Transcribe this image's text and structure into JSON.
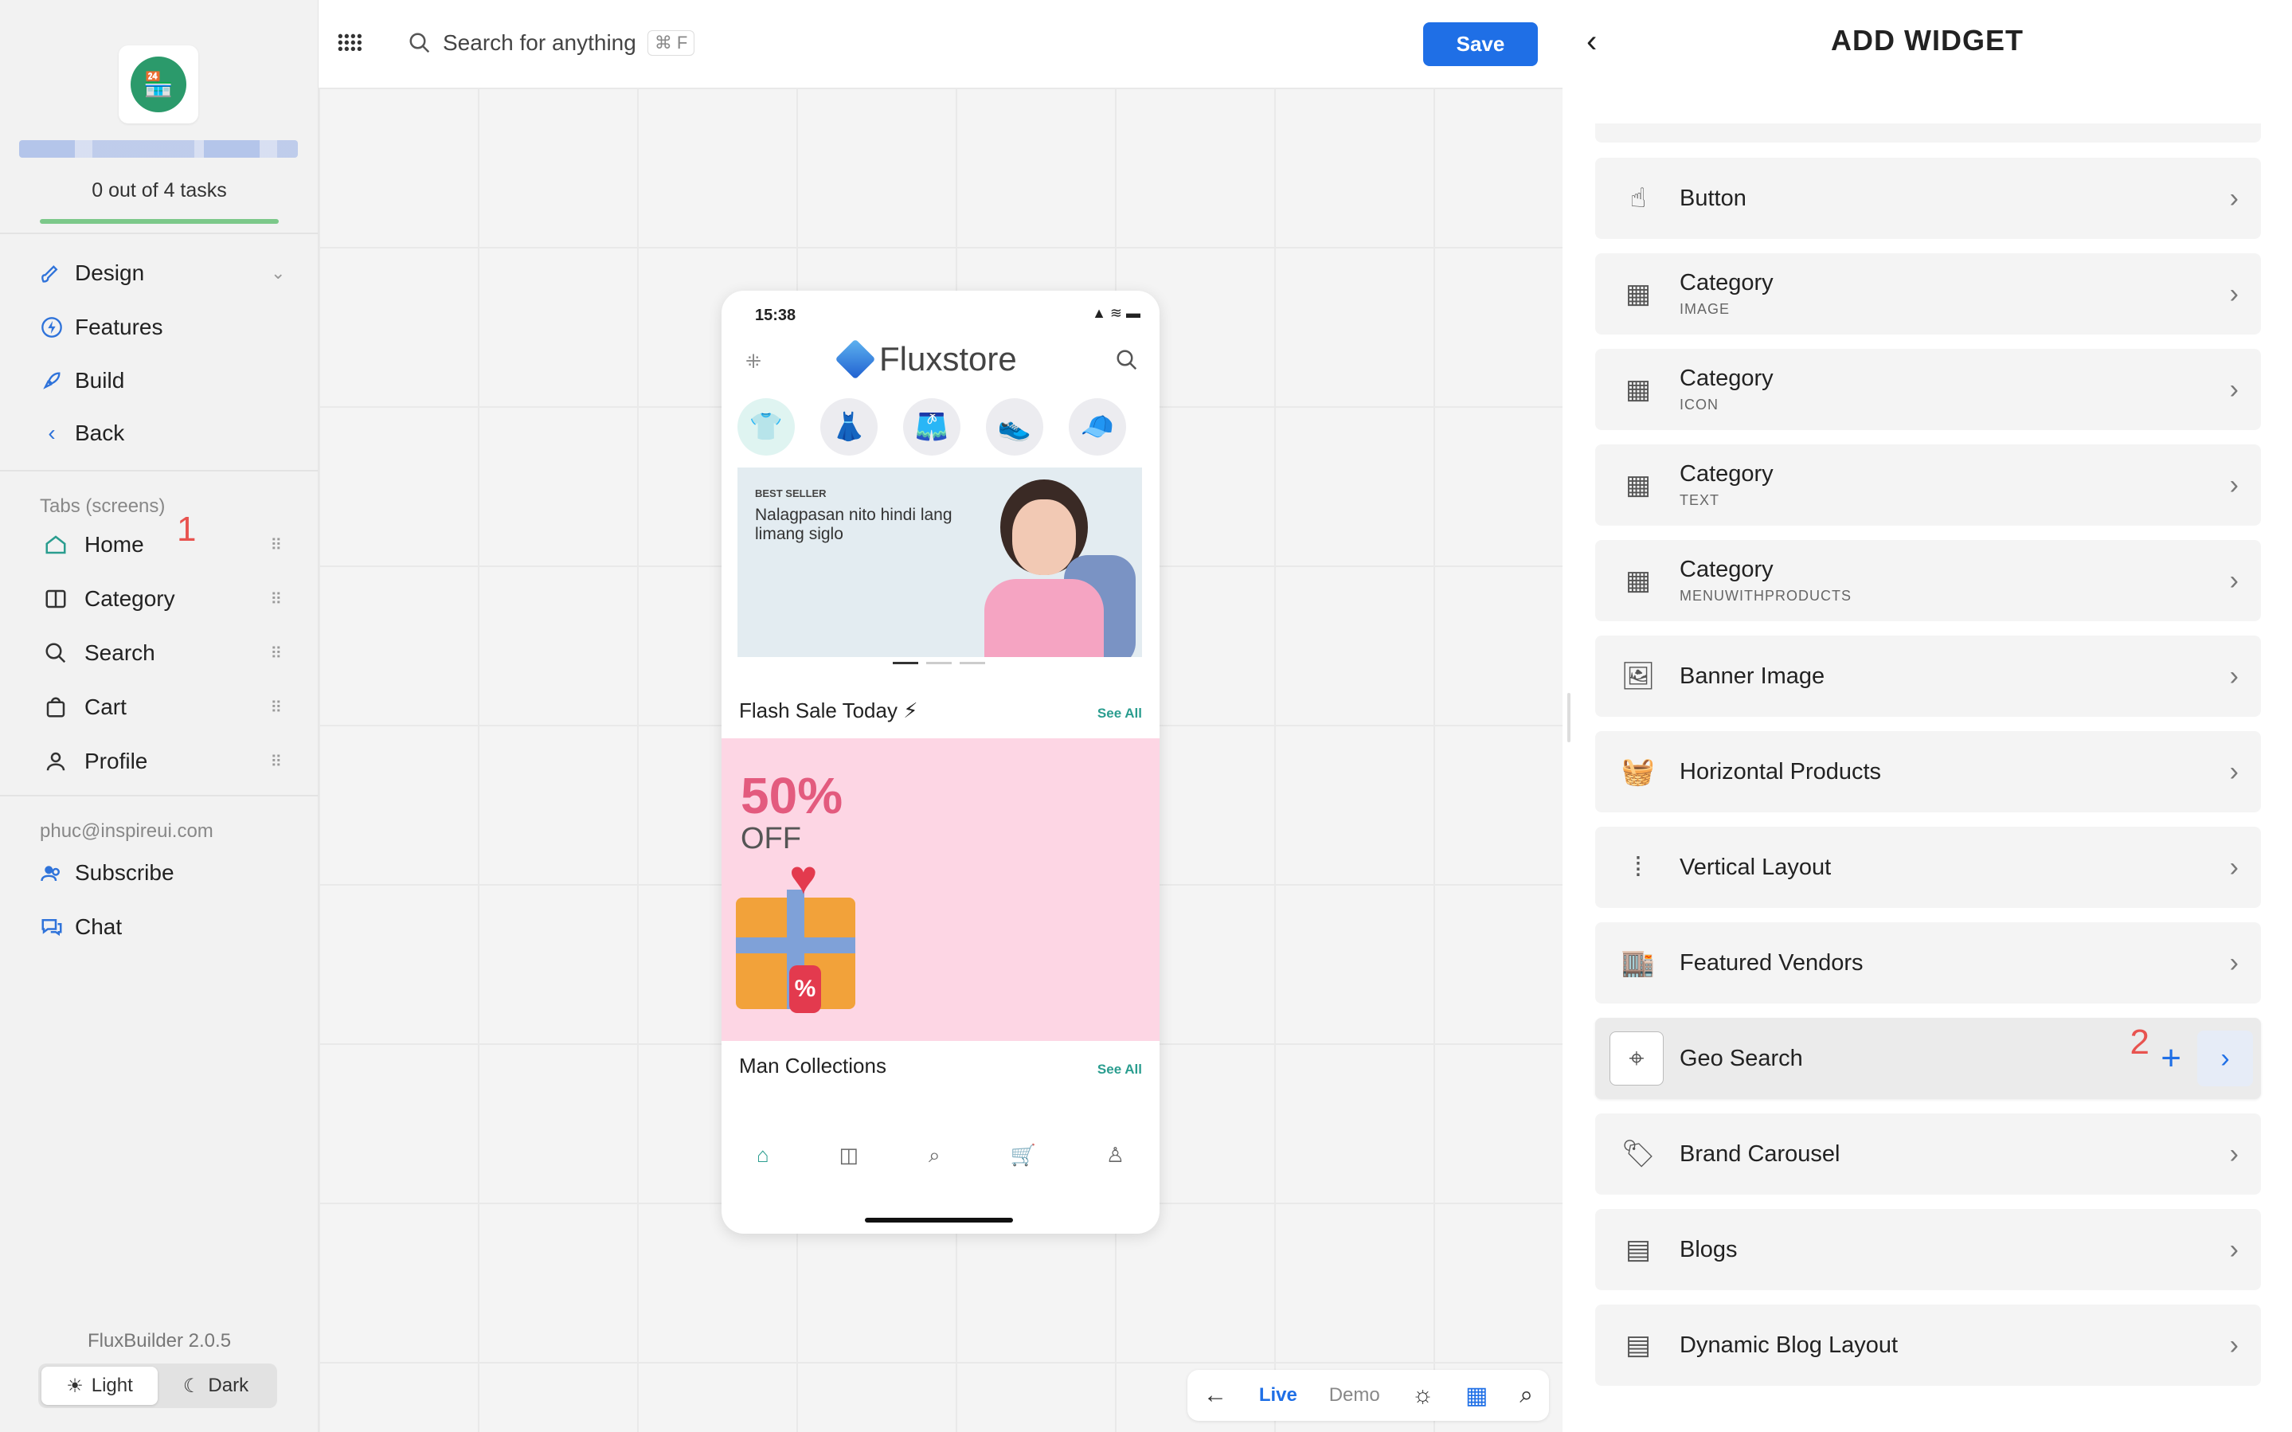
{
  "sidebar": {
    "tasks_label": "0 out of 4 tasks",
    "nav": [
      {
        "label": "Design",
        "icon": "brush-icon"
      },
      {
        "label": "Features",
        "icon": "bolt-icon"
      },
      {
        "label": "Build",
        "icon": "rocket-icon"
      },
      {
        "label": "Back",
        "icon": "chevron-left-icon"
      }
    ],
    "tabs_label": "Tabs (screens)",
    "tabs": [
      {
        "label": "Home",
        "icon": "home-icon"
      },
      {
        "label": "Category",
        "icon": "columns-icon"
      },
      {
        "label": "Search",
        "icon": "search-icon"
      },
      {
        "label": "Cart",
        "icon": "cart-icon"
      },
      {
        "label": "Profile",
        "icon": "user-icon"
      }
    ],
    "step_marker_1": "1",
    "email": "phuc@inspireui.com",
    "account_items": [
      {
        "label": "Subscribe",
        "icon": "users-icon"
      },
      {
        "label": "Chat",
        "icon": "chat-icon"
      }
    ],
    "version": "FluxBuilder 2.0.5",
    "theme": {
      "light": "Light",
      "dark": "Dark"
    }
  },
  "topbar": {
    "search_placeholder": "Search for anything",
    "shortcut": "⌘ F",
    "save_label": "Save"
  },
  "phone": {
    "time": "15:38",
    "brand": "Fluxstore",
    "banner_tag": "BEST SELLER",
    "banner_text": "Nalagpasan nito hindi lang limang siglo",
    "flash_title": "Flash Sale Today ⚡",
    "see_all": "See All",
    "sale_percent": "50%",
    "sale_off": "OFF",
    "sale_tag": "%",
    "collections_title": "Man Collections"
  },
  "preview_bar": {
    "live": "Live",
    "demo": "Demo"
  },
  "panel": {
    "title": "ADD WIDGET",
    "step_marker_2": "2",
    "widgets": [
      {
        "name": "Button",
        "sub": "",
        "icon": "hand-pointer-icon"
      },
      {
        "name": "Category",
        "sub": "IMAGE",
        "icon": "grid-icon"
      },
      {
        "name": "Category",
        "sub": "ICON",
        "icon": "grid-icon"
      },
      {
        "name": "Category",
        "sub": "TEXT",
        "icon": "grid-icon"
      },
      {
        "name": "Category",
        "sub": "MENUWITHPRODUCTS",
        "icon": "grid-icon"
      },
      {
        "name": "Banner Image",
        "sub": "",
        "icon": "image-icon"
      },
      {
        "name": "Horizontal Products",
        "sub": "",
        "icon": "basket-icon"
      },
      {
        "name": "Vertical Layout",
        "sub": "",
        "icon": "vertical-list-icon"
      },
      {
        "name": "Featured Vendors",
        "sub": "",
        "icon": "store-icon"
      },
      {
        "name": "Geo Search",
        "sub": "",
        "icon": "map-pin-icon"
      },
      {
        "name": "Brand Carousel",
        "sub": "",
        "icon": "tag-icon"
      },
      {
        "name": "Blogs",
        "sub": "",
        "icon": "document-icon"
      },
      {
        "name": "Dynamic Blog Layout",
        "sub": "",
        "icon": "document-icon"
      }
    ]
  },
  "colors": {
    "accent": "#1f6fe6",
    "progress": "#7cc88a",
    "marker": "#e8534f",
    "teal": "#2a9d8f"
  }
}
